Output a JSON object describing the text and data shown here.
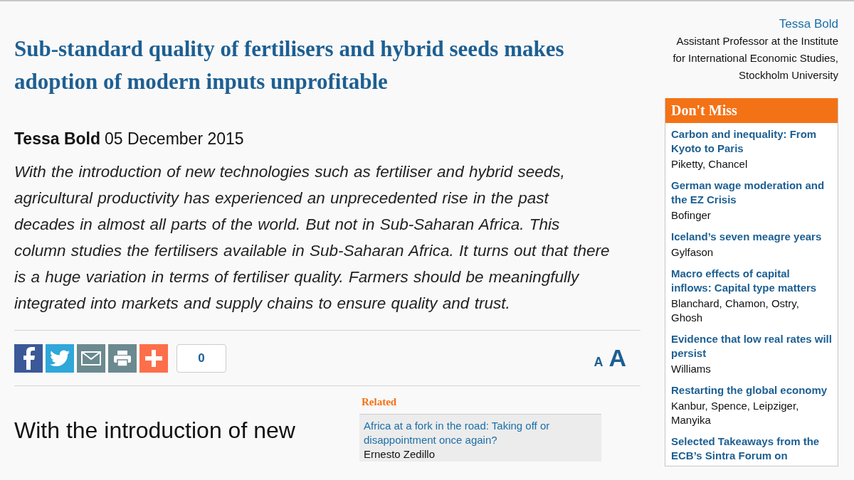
{
  "article": {
    "title": "Sub-standard quality of fertilisers and hybrid seeds makes adoption of modern inputs unprofitable",
    "author": "Tessa Bold",
    "date": "05 December 2015",
    "abstract": "With the introduction of new technologies such as fertiliser and hybrid seeds, agricultural productivity has experienced an unprecedented rise in the past decades in almost all parts of the world. But not in Sub-Saharan Africa. This column studies the fertilisers available in Sub-Saharan Africa. It turns out that there is a huge variation in terms of fertiliser quality. Farmers should be meaningfully integrated into markets and supply chains to ensure quality and trust.",
    "body_start": "With the introduction of new"
  },
  "share_bar": {
    "buttons": [
      {
        "kind": "facebook"
      },
      {
        "kind": "twitter"
      },
      {
        "kind": "email"
      },
      {
        "kind": "print"
      },
      {
        "kind": "more"
      }
    ],
    "count": "0",
    "font_sizes": [
      {
        "label": "A",
        "kind": "small"
      },
      {
        "label": "A",
        "kind": "large"
      }
    ]
  },
  "related": {
    "heading": "Related",
    "items": [
      {
        "title": "Africa at a fork in the road: Taking off or disappointment once again?",
        "authors": "Ernesto Zedillo"
      }
    ]
  },
  "author_box": {
    "name": "Tessa Bold",
    "affiliation": "Assistant Professor at the Institute for International Economic Studies, Stockholm University"
  },
  "dont_miss": {
    "heading": "Don't Miss",
    "items": [
      {
        "title": "Carbon and inequality: From Kyoto to Paris",
        "authors": "Piketty, Chancel"
      },
      {
        "title": "German wage moderation and the EZ Crisis",
        "authors": "Bofinger"
      },
      {
        "title": "Iceland’s seven meagre years",
        "authors": "Gylfason"
      },
      {
        "title": "Macro effects of capital inflows: Capital type matters",
        "authors": "Blanchard, Chamon, Ostry, Ghosh"
      },
      {
        "title": "Evidence that low real rates will persist",
        "authors": "Williams"
      },
      {
        "title": "Restarting the global economy",
        "authors": "Kanbur, Spence, Leipziger, Manyika"
      },
      {
        "title": "Selected Takeaways from the ECB’s Sintra Forum on"
      }
    ]
  }
}
